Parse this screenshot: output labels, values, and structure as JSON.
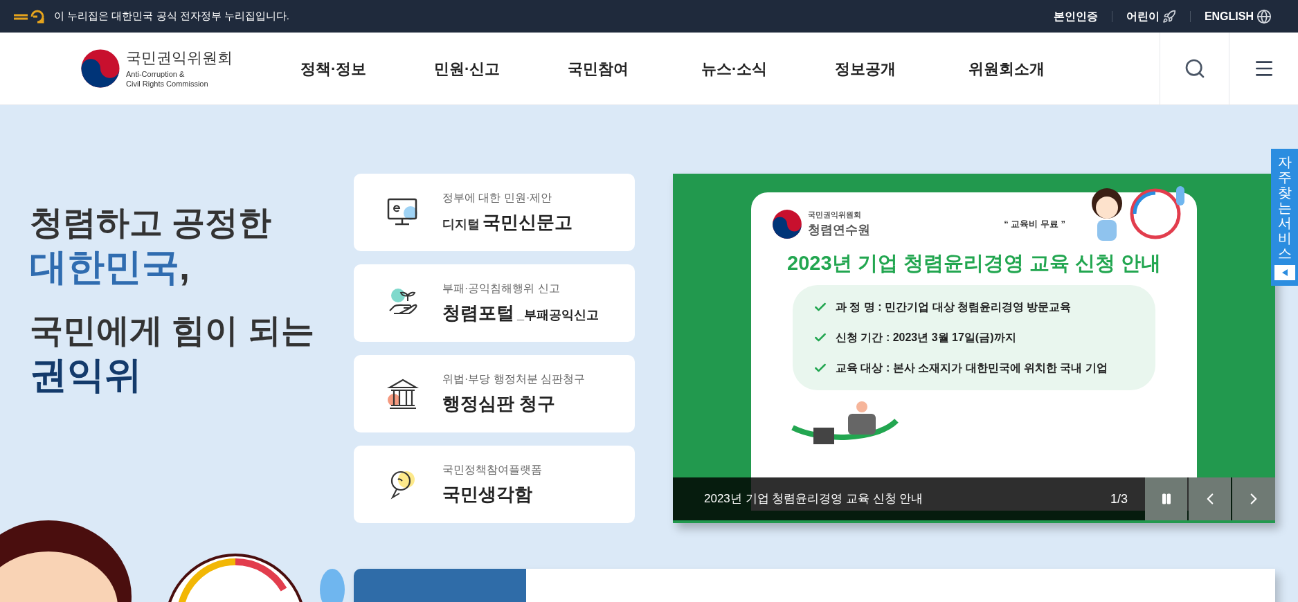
{
  "gov_banner": {
    "text": "이 누리집은 대한민국 공식 전자정부 누리집입니다."
  },
  "utility_links": [
    {
      "label": "본인인증",
      "kind": "text"
    },
    {
      "label": "어린이",
      "kind": "rocket"
    },
    {
      "label": "ENGLISH",
      "kind": "globe"
    }
  ],
  "logo": {
    "name": "국민권익위원회",
    "english_line_1": "Anti-Corruption &",
    "english_line_2": "Civil Rights Commission"
  },
  "nav": [
    {
      "label": "정책·정보"
    },
    {
      "label": "민원·신고"
    },
    {
      "label": "국민참여"
    },
    {
      "label": "뉴스·소식"
    },
    {
      "label": "정보공개"
    },
    {
      "label": "위원회소개"
    }
  ],
  "hero": {
    "line_1": "청렴하고 공정한",
    "line_2": "대한민국",
    "line_2_mark": ",",
    "line_3": "국민에게 힘이 되는",
    "line_4": "권익위"
  },
  "quick_links": [
    {
      "kind": "monitor",
      "subtitle": "정부에 대한 민원·제안",
      "prefix": "디지털",
      "title": "국민신문고"
    },
    {
      "kind": "plant",
      "subtitle": "부패·공익침해행위 신고",
      "title": "청렴포털",
      "suffix": "_부패공익신고"
    },
    {
      "kind": "building",
      "subtitle": "위법·부당 행정처분 심판청구",
      "title": "행정심판 청구"
    },
    {
      "kind": "bulb",
      "subtitle": "국민정책참여플랫폼",
      "title": "국민생각함"
    }
  ],
  "slider": {
    "slide": {
      "org_small": "국민권익위원회",
      "org": "청렴연수원",
      "tagline": "“ 교육비 무료 ”",
      "heading": "2023년 기업 청렴윤리경영 교육 신청 안내",
      "items": [
        "과 정 명 : 민간기업 대상 청렴윤리경영 방문교육",
        "신청 기간 : 2023년 3월 17일(금)까지",
        "교육 대상 : 본사 소재지가 대한민국에 위치한 국내 기업"
      ]
    },
    "caption": "2023년 기업 청렴윤리경영 교육 신청 안내",
    "counter": "1/3",
    "playing": true
  },
  "side_tab": {
    "label": "자주찾는서비스",
    "expanded": false
  }
}
